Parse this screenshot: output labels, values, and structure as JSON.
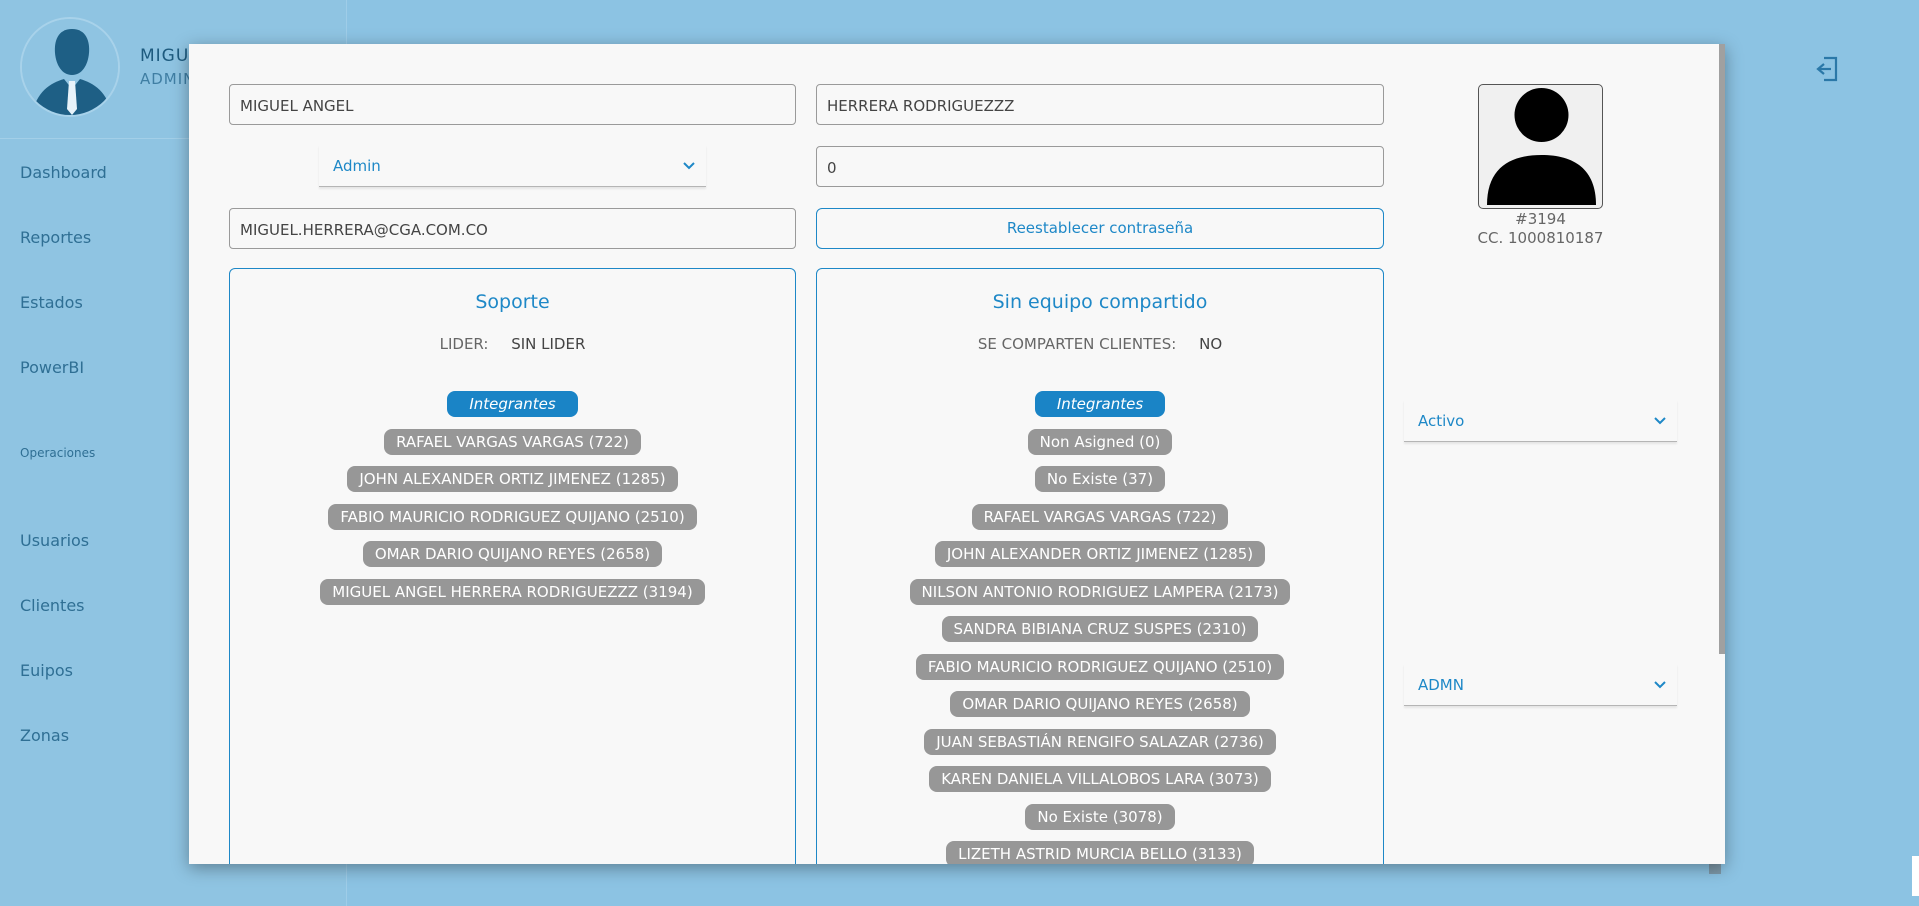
{
  "sidebar": {
    "user_name": "MIGU",
    "user_role": "ADMIN",
    "items": [
      {
        "label": "Dashboard"
      },
      {
        "label": "Reportes"
      },
      {
        "label": "Estados"
      },
      {
        "label": "PowerBI"
      },
      {
        "label": "Operaciones"
      },
      {
        "label": "Usuarios"
      },
      {
        "label": "Clientes"
      },
      {
        "label": "Euipos"
      },
      {
        "label": "Zonas"
      }
    ]
  },
  "form": {
    "first_name": "MIGUEL ANGEL",
    "last_name": "HERRERA RODRIGUEZZZ",
    "role_select": "Admin",
    "number_field": "0",
    "email": "MIGUEL.HERRERA@CGA.COM.CO",
    "reset_password": "Reestablecer contraseña"
  },
  "photo": {
    "user_id": "#3194",
    "cc": "CC. 1000810187"
  },
  "status_select": "Activo",
  "zone_select": "ADMN",
  "team_panel": {
    "title": "Soporte",
    "leader_label": "LIDER:",
    "leader_value": "SIN LIDER",
    "members_badge": "Integrantes",
    "members": [
      "RAFAEL VARGAS VARGAS (722)",
      "JOHN ALEXANDER ORTIZ JIMENEZ (1285)",
      "FABIO MAURICIO RODRIGUEZ QUIJANO (2510)",
      "OMAR DARIO QUIJANO REYES (2658)",
      "MIGUEL ANGEL HERRERA RODRIGUEZZZ (3194)"
    ]
  },
  "shared_panel": {
    "title": "Sin equipo compartido",
    "shared_label": "SE COMPARTEN CLIENTES:",
    "shared_value": "NO",
    "members_badge": "Integrantes",
    "members": [
      "Non Asigned (0)",
      "No Existe (37)",
      "RAFAEL VARGAS VARGAS (722)",
      "JOHN ALEXANDER ORTIZ JIMENEZ (1285)",
      "NILSON ANTONIO RODRIGUEZ LAMPERA (2173)",
      "SANDRA BIBIANA CRUZ SUSPES (2310)",
      "FABIO MAURICIO RODRIGUEZ QUIJANO (2510)",
      "OMAR DARIO QUIJANO REYES (2658)",
      "JUAN SEBASTIÁN RENGIFO SALAZAR (2736)",
      "KAREN DANIELA VILLALOBOS LARA (3073)",
      "No Existe (3078)",
      "LIZETH ASTRID MURCIA BELLO (3133)"
    ]
  },
  "colors": {
    "accent": "#1e88c7",
    "chip": "#979797",
    "background": "#8cc3e3"
  }
}
